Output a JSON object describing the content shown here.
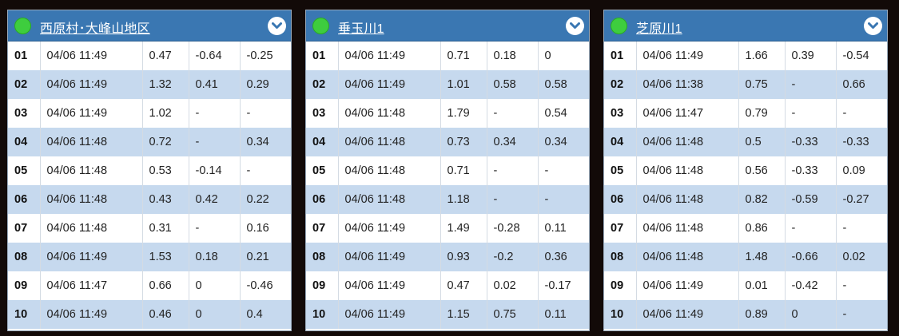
{
  "panels": [
    {
      "title": "西原村･大峰山地区",
      "status_color": "#3ecd3e",
      "rows": [
        {
          "id": "01",
          "time": "04/06 11:49",
          "v1": "0.47",
          "v2": "-0.64",
          "v3": "-0.25"
        },
        {
          "id": "02",
          "time": "04/06 11:49",
          "v1": "1.32",
          "v2": "0.41",
          "v3": "0.29"
        },
        {
          "id": "03",
          "time": "04/06 11:49",
          "v1": "1.02",
          "v2": "-",
          "v3": "-"
        },
        {
          "id": "04",
          "time": "04/06 11:48",
          "v1": "0.72",
          "v2": "-",
          "v3": "0.34"
        },
        {
          "id": "05",
          "time": "04/06 11:48",
          "v1": "0.53",
          "v2": "-0.14",
          "v3": "-"
        },
        {
          "id": "06",
          "time": "04/06 11:48",
          "v1": "0.43",
          "v2": "0.42",
          "v3": "0.22"
        },
        {
          "id": "07",
          "time": "04/06 11:48",
          "v1": "0.31",
          "v2": "-",
          "v3": "0.16"
        },
        {
          "id": "08",
          "time": "04/06 11:49",
          "v1": "1.53",
          "v2": "0.18",
          "v3": "0.21"
        },
        {
          "id": "09",
          "time": "04/06 11:47",
          "v1": "0.66",
          "v2": "0",
          "v3": "-0.46"
        },
        {
          "id": "10",
          "time": "04/06 11:49",
          "v1": "0.46",
          "v2": "0",
          "v3": "0.4"
        }
      ]
    },
    {
      "title": "垂玉川1",
      "status_color": "#3ecd3e",
      "rows": [
        {
          "id": "01",
          "time": "04/06 11:49",
          "v1": "0.71",
          "v2": "0.18",
          "v3": "0"
        },
        {
          "id": "02",
          "time": "04/06 11:49",
          "v1": "1.01",
          "v2": "0.58",
          "v3": "0.58"
        },
        {
          "id": "03",
          "time": "04/06 11:48",
          "v1": "1.79",
          "v2": "-",
          "v3": "0.54"
        },
        {
          "id": "04",
          "time": "04/06 11:48",
          "v1": "0.73",
          "v2": "0.34",
          "v3": "0.34"
        },
        {
          "id": "05",
          "time": "04/06 11:48",
          "v1": "0.71",
          "v2": "-",
          "v3": "-"
        },
        {
          "id": "06",
          "time": "04/06 11:48",
          "v1": "1.18",
          "v2": "-",
          "v3": "-"
        },
        {
          "id": "07",
          "time": "04/06 11:49",
          "v1": "1.49",
          "v2": "-0.28",
          "v3": "0.11"
        },
        {
          "id": "08",
          "time": "04/06 11:49",
          "v1": "0.93",
          "v2": "-0.2",
          "v3": "0.36"
        },
        {
          "id": "09",
          "time": "04/06 11:49",
          "v1": "0.47",
          "v2": "0.02",
          "v3": "-0.17"
        },
        {
          "id": "10",
          "time": "04/06 11:49",
          "v1": "1.15",
          "v2": "0.75",
          "v3": "0.11"
        }
      ]
    },
    {
      "title": "芝原川1",
      "status_color": "#3ecd3e",
      "rows": [
        {
          "id": "01",
          "time": "04/06 11:49",
          "v1": "1.66",
          "v2": "0.39",
          "v3": "-0.54"
        },
        {
          "id": "02",
          "time": "04/06 11:38",
          "v1": "0.75",
          "v2": "-",
          "v3": "0.66"
        },
        {
          "id": "03",
          "time": "04/06 11:47",
          "v1": "0.79",
          "v2": "-",
          "v3": "-"
        },
        {
          "id": "04",
          "time": "04/06 11:48",
          "v1": "0.5",
          "v2": "-0.33",
          "v3": "-0.33"
        },
        {
          "id": "05",
          "time": "04/06 11:48",
          "v1": "0.56",
          "v2": "-0.33",
          "v3": "0.09"
        },
        {
          "id": "06",
          "time": "04/06 11:48",
          "v1": "0.82",
          "v2": "-0.59",
          "v3": "-0.27"
        },
        {
          "id": "07",
          "time": "04/06 11:48",
          "v1": "0.86",
          "v2": "-",
          "v3": "-"
        },
        {
          "id": "08",
          "time": "04/06 11:48",
          "v1": "1.48",
          "v2": "-0.66",
          "v3": "0.02"
        },
        {
          "id": "09",
          "time": "04/06 11:49",
          "v1": "0.01",
          "v2": "-0.42",
          "v3": "-"
        },
        {
          "id": "10",
          "time": "04/06 11:49",
          "v1": "0.89",
          "v2": "0",
          "v3": "-"
        }
      ]
    }
  ],
  "icons": {
    "status": "status-dot-icon",
    "expand": "chevron-down-icon"
  }
}
